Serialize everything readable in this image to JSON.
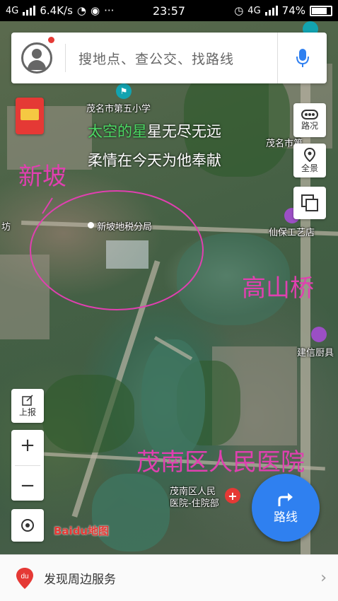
{
  "status": {
    "network": "4G",
    "speed": "6.4K/s",
    "time": "23:57",
    "network_right": "4G",
    "battery": "74%",
    "more": "···"
  },
  "search": {
    "placeholder": "搜地点、查公交、找路线"
  },
  "tools_right": {
    "traffic": "路况",
    "panorama": "全景"
  },
  "tools_left": {
    "report": "上报",
    "zoom_in": "+",
    "zoom_out": "−"
  },
  "pois": {
    "school": "茂名市第五小学",
    "tax_office": "新坡地税分局",
    "craft_shop": "仙保工艺店",
    "school_right": "茂名市第…",
    "store": "建信厨具",
    "left_edge": "坊",
    "hospital": "茂南区人民医院-住院部",
    "hospital_line1": "茂南区人民",
    "hospital_line2": "医院-住院部"
  },
  "annotations": {
    "xinpo": "新坡",
    "gaoshanqiao": "高山桥",
    "hospital": "茂南区人民医院"
  },
  "lyrics": {
    "line1_a": "太空的星",
    "line1_b": "星无尽无远",
    "line2": "柔情在今天为他奉献"
  },
  "logo": {
    "text": "Baidu地图"
  },
  "route_button": {
    "label": "路线"
  },
  "bottom": {
    "text": "发现周边服务"
  },
  "colors": {
    "accent": "#2f80f0",
    "annotation": "#e040b0",
    "lyric_highlight": "#4cd964"
  }
}
